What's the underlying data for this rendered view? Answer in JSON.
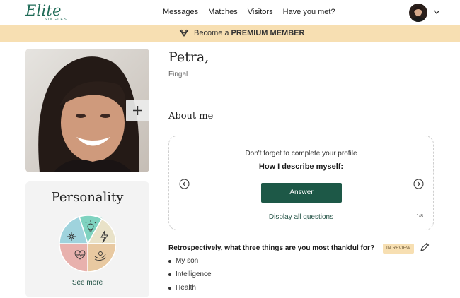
{
  "header": {
    "logo_text": "Elite",
    "logo_sub": "SINGLES",
    "nav": [
      {
        "label": "Messages"
      },
      {
        "label": "Matches"
      },
      {
        "label": "Visitors"
      },
      {
        "label": "Have you met?"
      }
    ]
  },
  "banner": {
    "text_prefix": "Become a",
    "text_bold": "PREMIUM MEMBER"
  },
  "profile": {
    "name": "Petra,",
    "location": "Fingal"
  },
  "personality": {
    "title": "Personality",
    "see_more": "See more",
    "segment_colors": [
      "#7fd3c0",
      "#e9e2c8",
      "#e8c9a1",
      "#e8b1ad",
      "#9fd3dd"
    ],
    "segment_icons": [
      "lightbulb-icon",
      "lightning-icon",
      "hands-icon",
      "heart-icon",
      "network-icon"
    ]
  },
  "about": {
    "title": "About me",
    "card": {
      "prompt": "Don't forget to complete your profile",
      "question": "How I describe myself:",
      "answer_label": "Answer",
      "display_all": "Display all questions",
      "counter": "1/8"
    },
    "answered": {
      "question": "Retrospectively, what three things are you most thankful for?",
      "badge": "IN REVIEW",
      "answers": [
        "My son",
        "Intelligence",
        "Health"
      ]
    }
  },
  "colors": {
    "brand_green": "#1d5847",
    "banner_bg": "#f7dfb2"
  }
}
